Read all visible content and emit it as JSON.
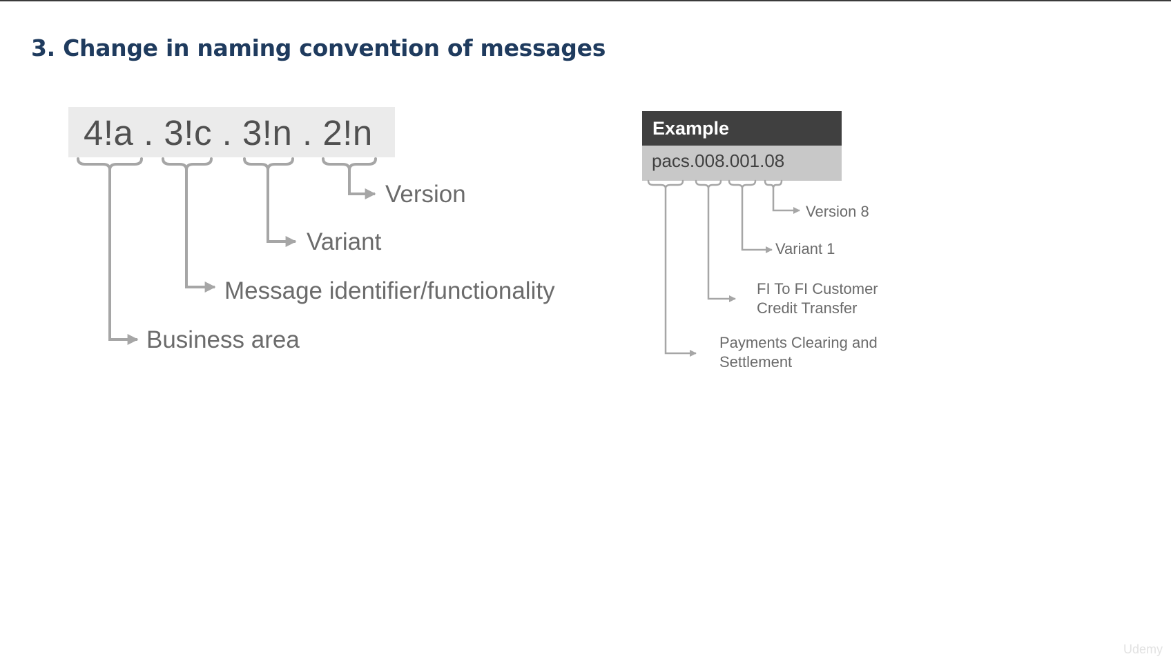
{
  "title": "3. Change in naming convention of messages",
  "format": {
    "pattern": "4!a . 3!c . 3!n . 2!n",
    "labels": {
      "version": "Version",
      "variant": "Variant",
      "message_identifier": "Message identifier/functionality",
      "business_area": "Business area"
    }
  },
  "example": {
    "header": "Example",
    "value": "pacs.008.001.08",
    "labels": {
      "version": "Version 8",
      "variant": "Variant 1",
      "message_identifier_line1": "FI To FI Customer",
      "message_identifier_line2": "Credit Transfer",
      "business_area_line1": "Payments Clearing and",
      "business_area_line2": "Settlement"
    }
  },
  "watermark": "Udemy",
  "colors": {
    "title": "#1f3b5e",
    "connector": "#a6a6a6",
    "label": "#6b6b6b",
    "example_header_bg": "#404040",
    "example_body_bg": "#c8c8c8"
  }
}
